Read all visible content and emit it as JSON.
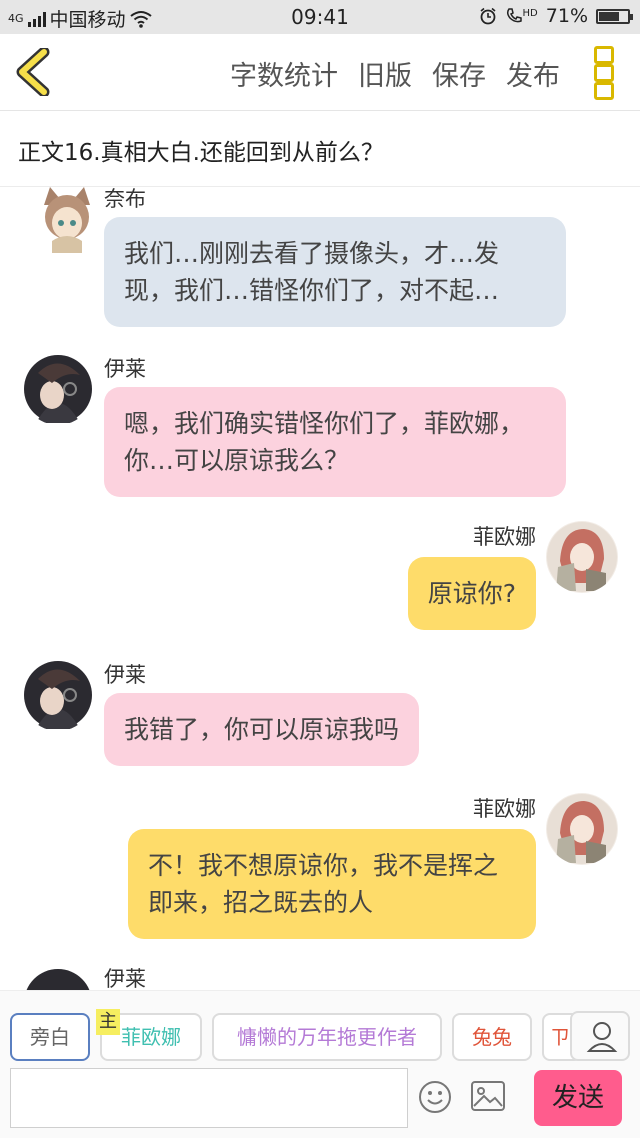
{
  "status": {
    "network": "4G",
    "carrier": "中国移动",
    "time": "09:41",
    "hd": "HD",
    "battery": "71%",
    "battery_level": 0.71
  },
  "header": {
    "actions": [
      "字数统计",
      "旧版",
      "保存",
      "发布"
    ]
  },
  "chapter_title": "正文16.真相大白.还能回到从前么？",
  "messages": [
    {
      "speaker": "奈布",
      "text": "我们…刚刚去看了摄像头，才…发现，我们…错怪你们了，对不起…"
    },
    {
      "speaker": "伊莱",
      "text": "嗯，我们确实错怪你们了，菲欧娜，你…可以原谅我么？"
    },
    {
      "speaker": "菲欧娜",
      "text": "原谅你?"
    },
    {
      "speaker": "伊莱",
      "text": "我错了，你可以原谅我吗"
    },
    {
      "speaker": "菲欧娜",
      "text": "不！我不想原谅你，我不是挥之即来，招之既去的人"
    },
    {
      "speaker": "伊莱",
      "text": ""
    }
  ],
  "roles": [
    "旁白",
    "菲欧娜",
    "慵懒的万年拖更作者",
    "兔兔",
    "ㄗ"
  ],
  "main_badge": "主",
  "colors": {
    "accent": "#d9b800",
    "send": "#ff5c8d",
    "bubble_blue": "#dde5ee",
    "bubble_pink": "#fcd2de",
    "bubble_yellow": "#fedc6a",
    "role_fiona": "#3fbfb0",
    "role_author": "#b47ad6",
    "role_tutu": "#e0553a"
  },
  "input": {
    "placeholder": "",
    "send_label": "发送"
  }
}
